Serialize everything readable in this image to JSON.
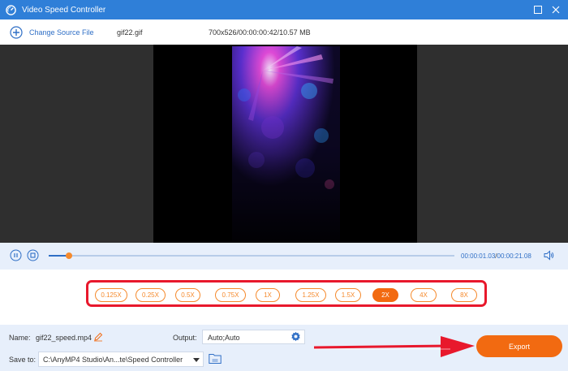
{
  "window": {
    "title": "Video Speed Controller"
  },
  "toolbar": {
    "change_source_label": "Change Source File",
    "file_name": "gif22.gif",
    "file_info": "700x526/00:00:00:42/10.57 MB"
  },
  "playback": {
    "current_time": "00:00:01.03",
    "separator": "/",
    "total_time": "00:00:21.08",
    "progress_fraction": 0.05
  },
  "speed": {
    "options": [
      "0.125X",
      "0.25X",
      "0.5X",
      "0.75X",
      "1X",
      "1.25X",
      "1.5X",
      "2X",
      "4X",
      "8X"
    ],
    "selected": "2X"
  },
  "bottom": {
    "name_label": "Name:",
    "name_value": "gif22_speed.mp4",
    "output_label": "Output:",
    "output_value": "Auto;Auto",
    "save_to_label": "Save to:",
    "save_to_value": "C:\\AnyMP4 Studio\\An...te\\Speed Controller",
    "export_label": "Export"
  },
  "colors": {
    "accent": "#2f7fd8",
    "orange": "#f26a11",
    "highlight_red": "#e8182c"
  }
}
